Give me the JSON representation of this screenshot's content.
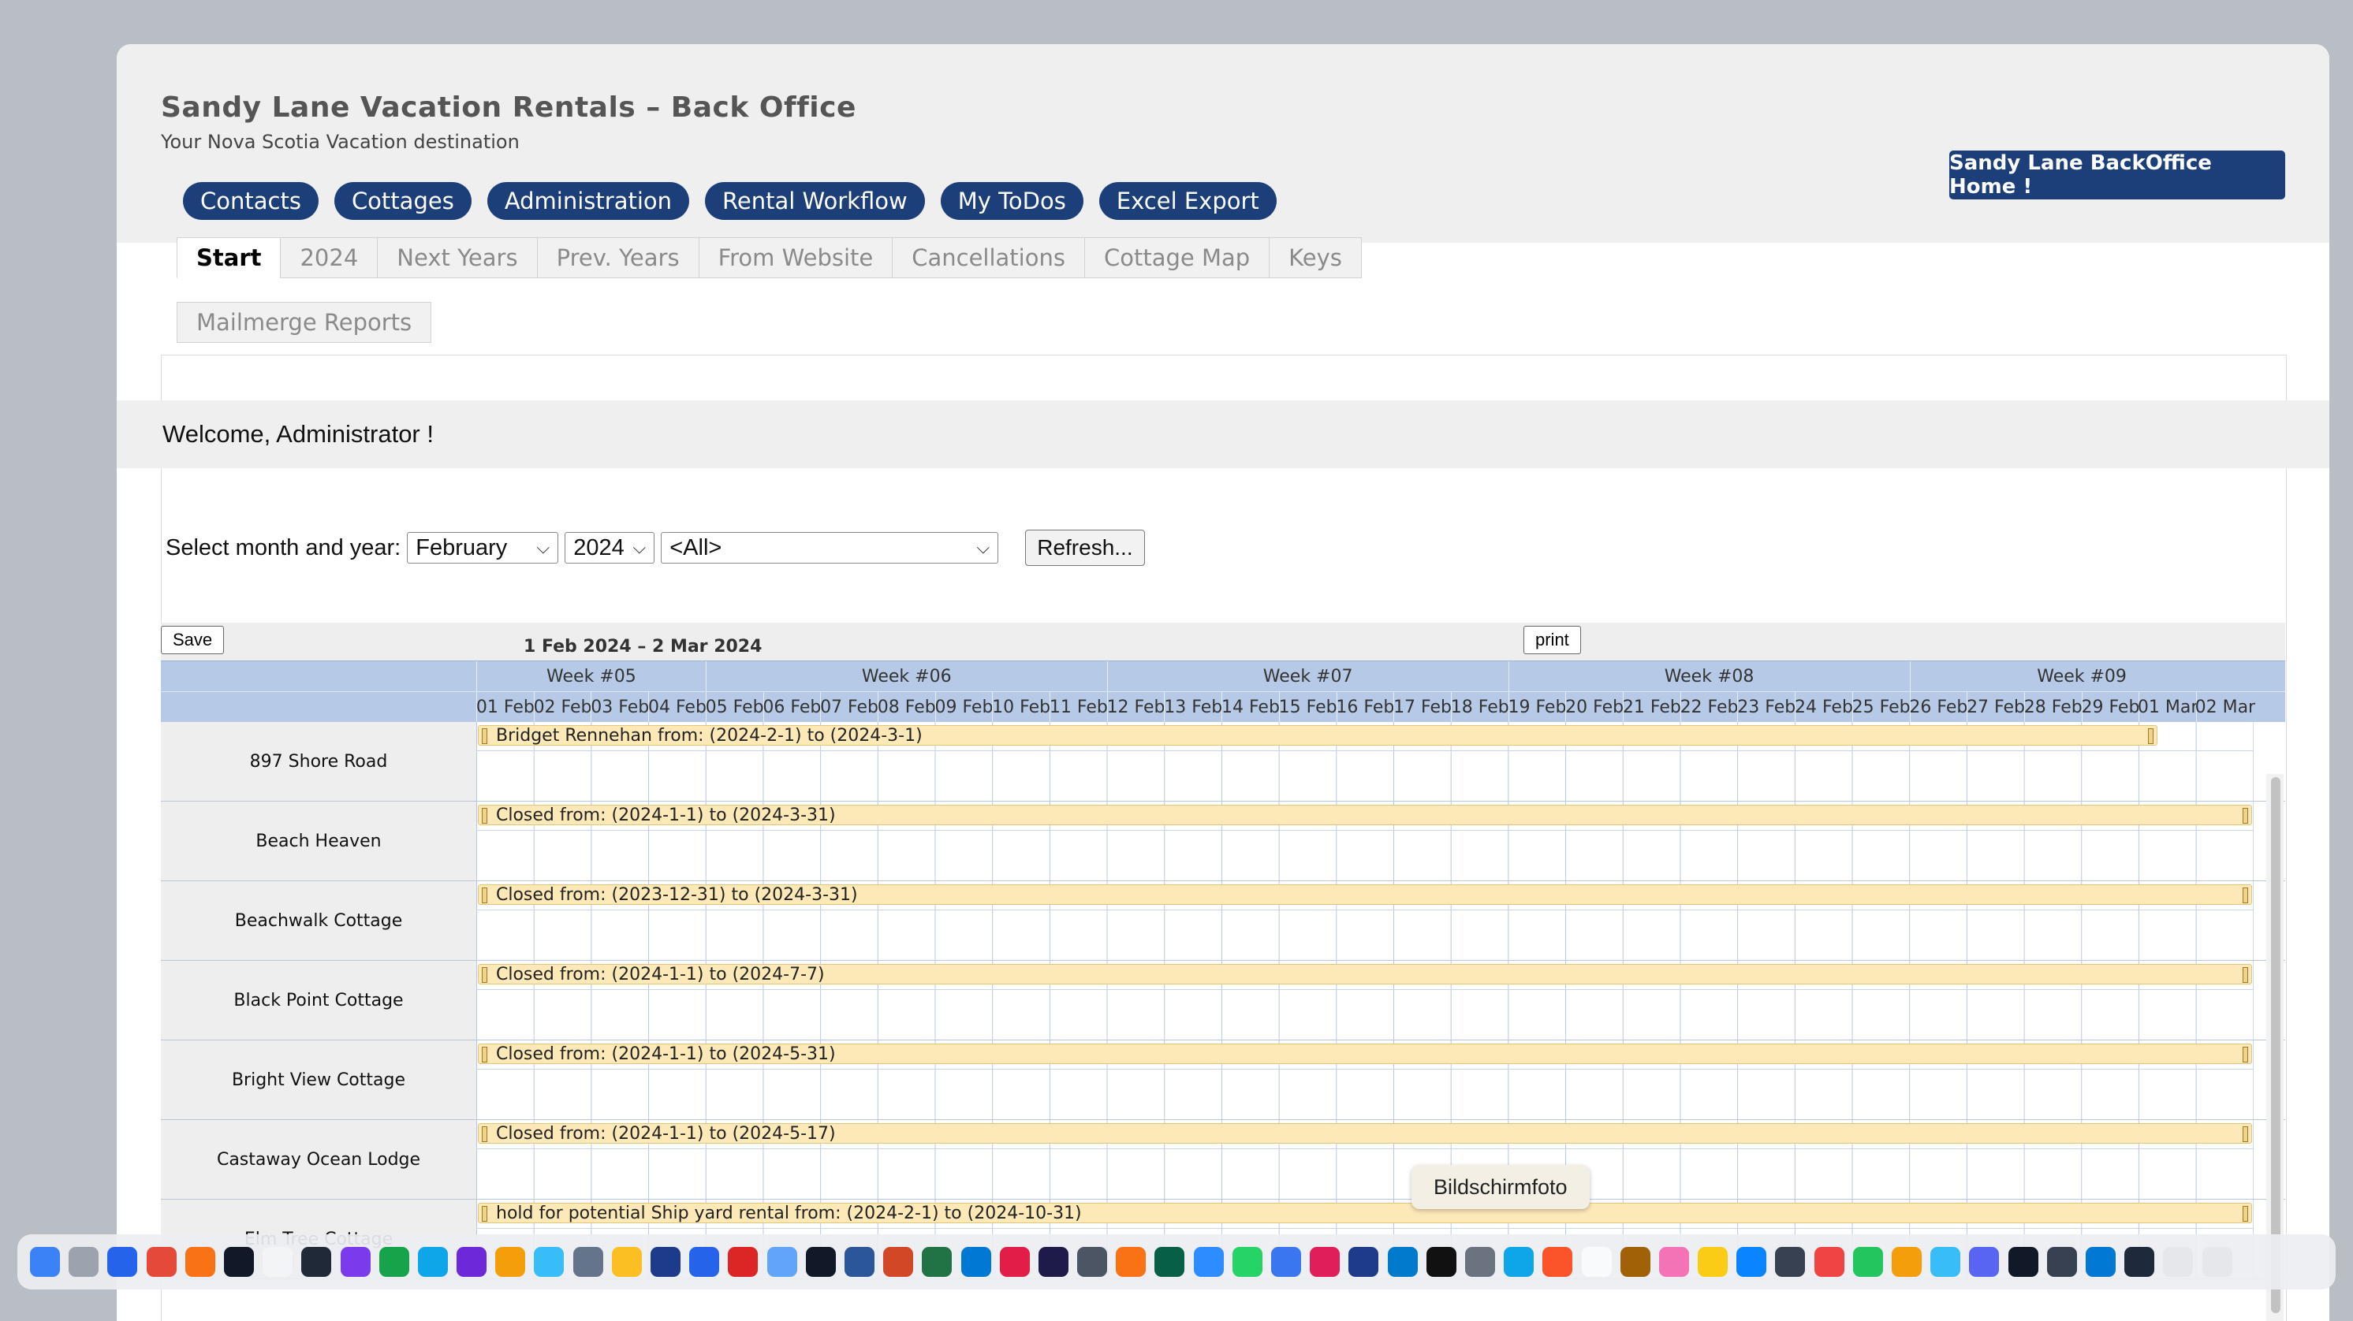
{
  "header": {
    "title": "Sandy Lane Vacation Rentals – Back Office",
    "subtitle": "Your Nova Scotia Vacation destination",
    "home_button": "Sandy Lane BackOffice Home !"
  },
  "main_nav": [
    "Contacts",
    "Cottages",
    "Administration",
    "Rental Workflow",
    "My ToDos",
    "Excel Export"
  ],
  "tabs": [
    "Start",
    "2024",
    "Next Years",
    "Prev. Years",
    "From Website",
    "Cancellations",
    "Cottage Map",
    "Keys"
  ],
  "active_tab": "Start",
  "tab_row2": "Mailmerge Reports",
  "welcome": "Welcome, Administrator !",
  "filter": {
    "label": "Select month and year:",
    "month": "February",
    "year": "2024",
    "cottage": "<All>",
    "refresh": "Refresh..."
  },
  "calendar": {
    "save": "Save",
    "print": "print",
    "range": "1 Feb 2024 – 2 Mar 2024",
    "weeks": [
      "Week #05",
      "Week #06",
      "Week #07",
      "Week #08",
      "Week #09"
    ],
    "days": [
      "01 Feb",
      "02 Feb",
      "03 Feb",
      "04 Feb",
      "05 Feb",
      "06 Feb",
      "07 Feb",
      "08 Feb",
      "09 Feb",
      "10 Feb",
      "11 Feb",
      "12 Feb",
      "13 Feb",
      "14 Feb",
      "15 Feb",
      "16 Feb",
      "17 Feb",
      "18 Feb",
      "19 Feb",
      "20 Feb",
      "21 Feb",
      "22 Feb",
      "23 Feb",
      "24 Feb",
      "25 Feb",
      "26 Feb",
      "27 Feb",
      "28 Feb",
      "29 Feb",
      "01 Mar",
      "02 Mar"
    ],
    "rows": [
      {
        "name": "897 Shore Road",
        "booking": "Bridget Rennehan from: (2024-2-1) to (2024-3-1)"
      },
      {
        "name": "Beach Heaven",
        "booking": "Closed from: (2024-1-1) to (2024-3-31)"
      },
      {
        "name": "Beachwalk Cottage",
        "booking": "Closed from: (2023-12-31) to (2024-3-31)"
      },
      {
        "name": "Black Point Cottage",
        "booking": "Closed from: (2024-1-1) to (2024-7-7)"
      },
      {
        "name": "Bright View Cottage",
        "booking": "Closed from: (2024-1-1) to (2024-5-31)"
      },
      {
        "name": "Castaway Ocean Lodge",
        "booking": "Closed from: (2024-1-1) to (2024-5-17)"
      },
      {
        "name": "Elm Tree Cottage",
        "booking": "hold for potential Ship yard rental from: (2024-2-1) to (2024-10-31)"
      }
    ]
  },
  "tooltip": "Bildschirmfoto",
  "dock_icons": [
    "finder-icon",
    "launchpad-icon",
    "safari-icon",
    "chrome-icon",
    "firefox-icon",
    "activity-monitor-icon",
    "textedit-icon",
    "affinity-icon",
    "affinity-designer-icon",
    "numbers-icon",
    "infinity-icon",
    "app-icon",
    "star-icon",
    "elephant-icon",
    "calculator-icon",
    "cyberduck-icon",
    "sourcetree-icon",
    "xcode-icon",
    "typora-icon",
    "folder-icon",
    "stocks-icon",
    "word-icon",
    "powerpoint-icon",
    "excel-icon",
    "outlook-icon",
    "acrobat-icon",
    "keystroke-icon",
    "calc-icon",
    "sketch-icon",
    "app-icon-2",
    "zoom-icon",
    "whatsapp-icon",
    "signal-icon",
    "slack-icon",
    "timer-icon",
    "vscode-icon",
    "terminal-icon",
    "screenshot-icon",
    "infinity-icon-2",
    "brave-icon",
    "calendar-icon",
    "archive-icon",
    "photos-icon",
    "notes-icon",
    "appstore-icon",
    "settings-icon",
    "toolbox-icon",
    "pages-icon",
    "keynote-icon",
    "globe-icon",
    "discord-icon",
    "pen-icon",
    "camera-icon",
    "windows-icon",
    "stack-icon",
    "document-icon",
    "trash-icon"
  ]
}
